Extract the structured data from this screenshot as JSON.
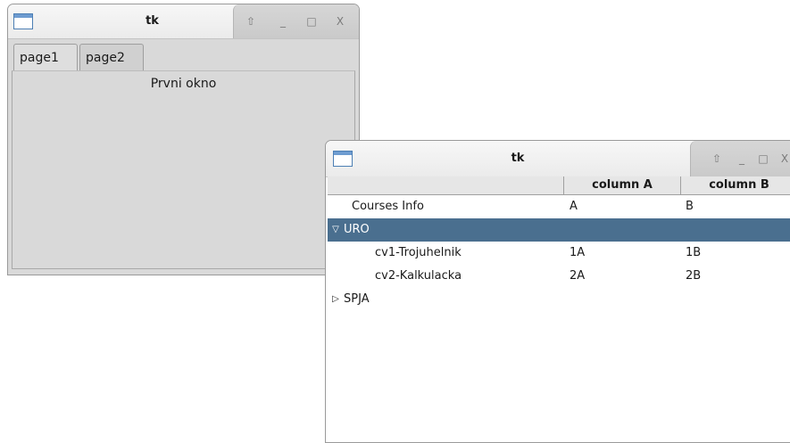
{
  "window1": {
    "title": "tk",
    "controls": {
      "up": "⇧",
      "minimize": "_",
      "maximize": "□",
      "close": "X"
    },
    "tabs": [
      {
        "label": "page1",
        "active": true
      },
      {
        "label": "page2",
        "active": false
      }
    ],
    "panel_text": "Prvni okno"
  },
  "window2": {
    "title": "tk",
    "controls": {
      "up": "⇧",
      "minimize": "_",
      "maximize": "□",
      "close": "X"
    },
    "columns": [
      "",
      "column A",
      "column B"
    ],
    "rows": [
      {
        "label": "Courses Info",
        "colA": "A",
        "colB": "B"
      },
      {
        "label": "URO",
        "colA": "",
        "colB": "",
        "expanded": true,
        "selected": true,
        "toggle": "▽"
      },
      {
        "label": "cv1-Trojuhelnik",
        "colA": "1A",
        "colB": "1B"
      },
      {
        "label": "cv2-Kalkulacka",
        "colA": "2A",
        "colB": "2B"
      },
      {
        "label": "SPJA",
        "colA": "",
        "colB": "",
        "expanded": false,
        "toggle": "▷"
      }
    ],
    "selection_color": "#4a6f8f"
  }
}
